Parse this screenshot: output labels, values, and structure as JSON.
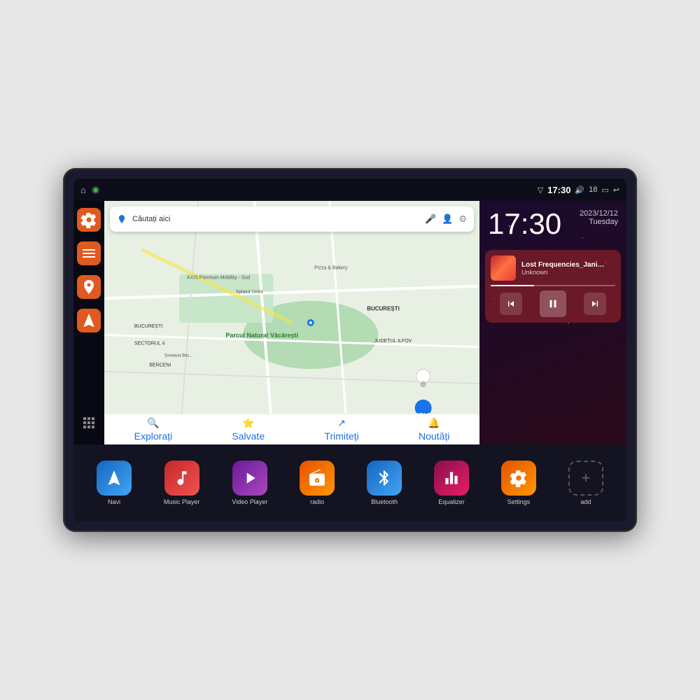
{
  "device": {
    "status_bar": {
      "left_icons": [
        "home",
        "maps"
      ],
      "wifi_icon": "wifi",
      "time": "17:30",
      "volume_icon": "volume",
      "battery_level": "18",
      "battery_icon": "battery",
      "back_icon": "back"
    },
    "clock": {
      "time": "17:30",
      "date": "2023/12/12",
      "day": "Tuesday"
    },
    "music": {
      "title": "Lost Frequencies_Janie...",
      "artist": "Unknown",
      "progress": 35
    },
    "map": {
      "search_placeholder": "Căutați aici",
      "labels": [
        "BUCUREȘTI",
        "JUDETUL ILFOV",
        "BERCENI",
        "BUCUREȘTI SECTORUL 4"
      ],
      "pois": [
        "Parcul Natural Văcărești",
        "Pizza & Bakery",
        "AXIS Premium Mobility - Sud"
      ],
      "bottom_items": [
        "Explorați",
        "Salvate",
        "Trimiteți",
        "Noutăți"
      ]
    },
    "apps": [
      {
        "id": "navi",
        "label": "Navi",
        "icon_class": "icon-navi",
        "icon": "▲"
      },
      {
        "id": "music-player",
        "label": "Music Player",
        "icon_class": "icon-music",
        "icon": "♪"
      },
      {
        "id": "video-player",
        "label": "Video Player",
        "icon_class": "icon-video",
        "icon": "▶"
      },
      {
        "id": "radio",
        "label": "radio",
        "icon_class": "icon-radio",
        "icon": "〰"
      },
      {
        "id": "bluetooth",
        "label": "Bluetooth",
        "icon_class": "icon-bt",
        "icon": "⚡"
      },
      {
        "id": "equalizer",
        "label": "Equalizer",
        "icon_class": "icon-eq",
        "icon": "≡"
      },
      {
        "id": "settings",
        "label": "Settings",
        "icon_class": "icon-settings",
        "icon": "⚙"
      },
      {
        "id": "add",
        "label": "add",
        "icon_class": "icon-add",
        "icon": "+"
      }
    ],
    "sidebar": [
      {
        "id": "settings",
        "icon": "⚙",
        "color": "#e05a20"
      },
      {
        "id": "files",
        "icon": "▬",
        "color": "#e05a20"
      },
      {
        "id": "map",
        "icon": "◉",
        "color": "#e05a20"
      },
      {
        "id": "navi",
        "icon": "▲",
        "color": "#e05a20"
      }
    ]
  }
}
